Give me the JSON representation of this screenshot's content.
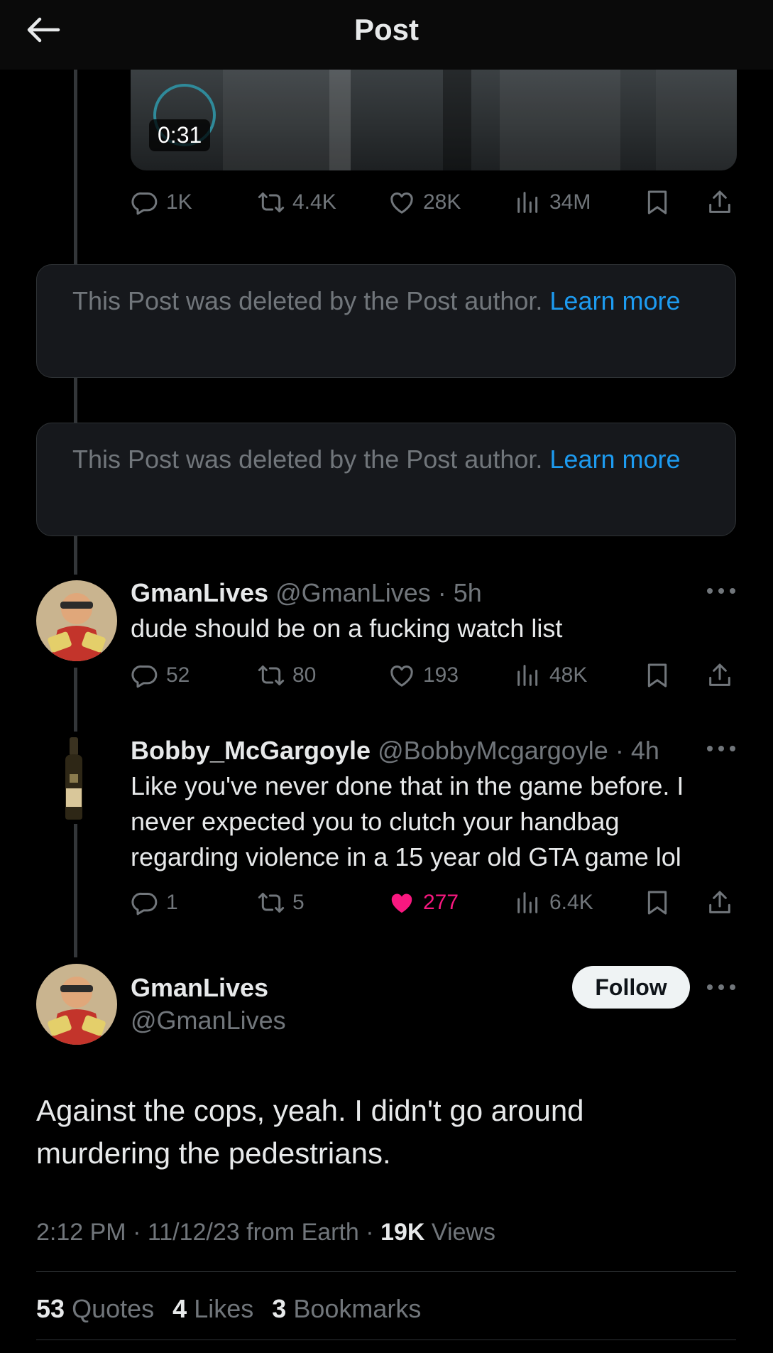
{
  "header": {
    "title": "Post"
  },
  "video": {
    "duration": "0:31"
  },
  "main_post_stats": {
    "replies": "1K",
    "reposts": "4.4K",
    "likes": "28K",
    "views": "34M"
  },
  "deleted_notice": {
    "text": "This Post was deleted by the Post author.",
    "link": "Learn more"
  },
  "reply1": {
    "name": "GmanLives",
    "handle": "@GmanLives",
    "time": "5h",
    "text": "dude should be on a fucking watch list",
    "stats": {
      "replies": "52",
      "reposts": "80",
      "likes": "193",
      "views": "48K"
    }
  },
  "reply2": {
    "name": "Bobby_McGargoyle",
    "handle": "@BobbyMcgargoyle",
    "time": "4h",
    "text": "Like you've never done that in the game before. I never expected you to clutch your handbag regarding violence in a 15 year old GTA game lol",
    "stats": {
      "replies": "1",
      "reposts": "5",
      "likes": "277",
      "views": "6.4K"
    },
    "liked": true
  },
  "focused": {
    "name": "GmanLives",
    "handle": "@GmanLives",
    "follow_label": "Follow",
    "text": "Against the cops, yeah. I didn't go around murdering the pedestrians.",
    "time": "2:12 PM",
    "date": "11/12/23",
    "location": "from Earth",
    "views_count": "19K",
    "views_label": "Views",
    "quotes_count": "53",
    "quotes_label": "Quotes",
    "likes_count": "4",
    "likes_label": "Likes",
    "bookmarks_count": "3",
    "bookmarks_label": "Bookmarks"
  },
  "colors": {
    "accent": "#1d9bf0",
    "like": "#f91880",
    "muted": "#71767b",
    "text": "#e7e9ea",
    "background": "#000000"
  }
}
